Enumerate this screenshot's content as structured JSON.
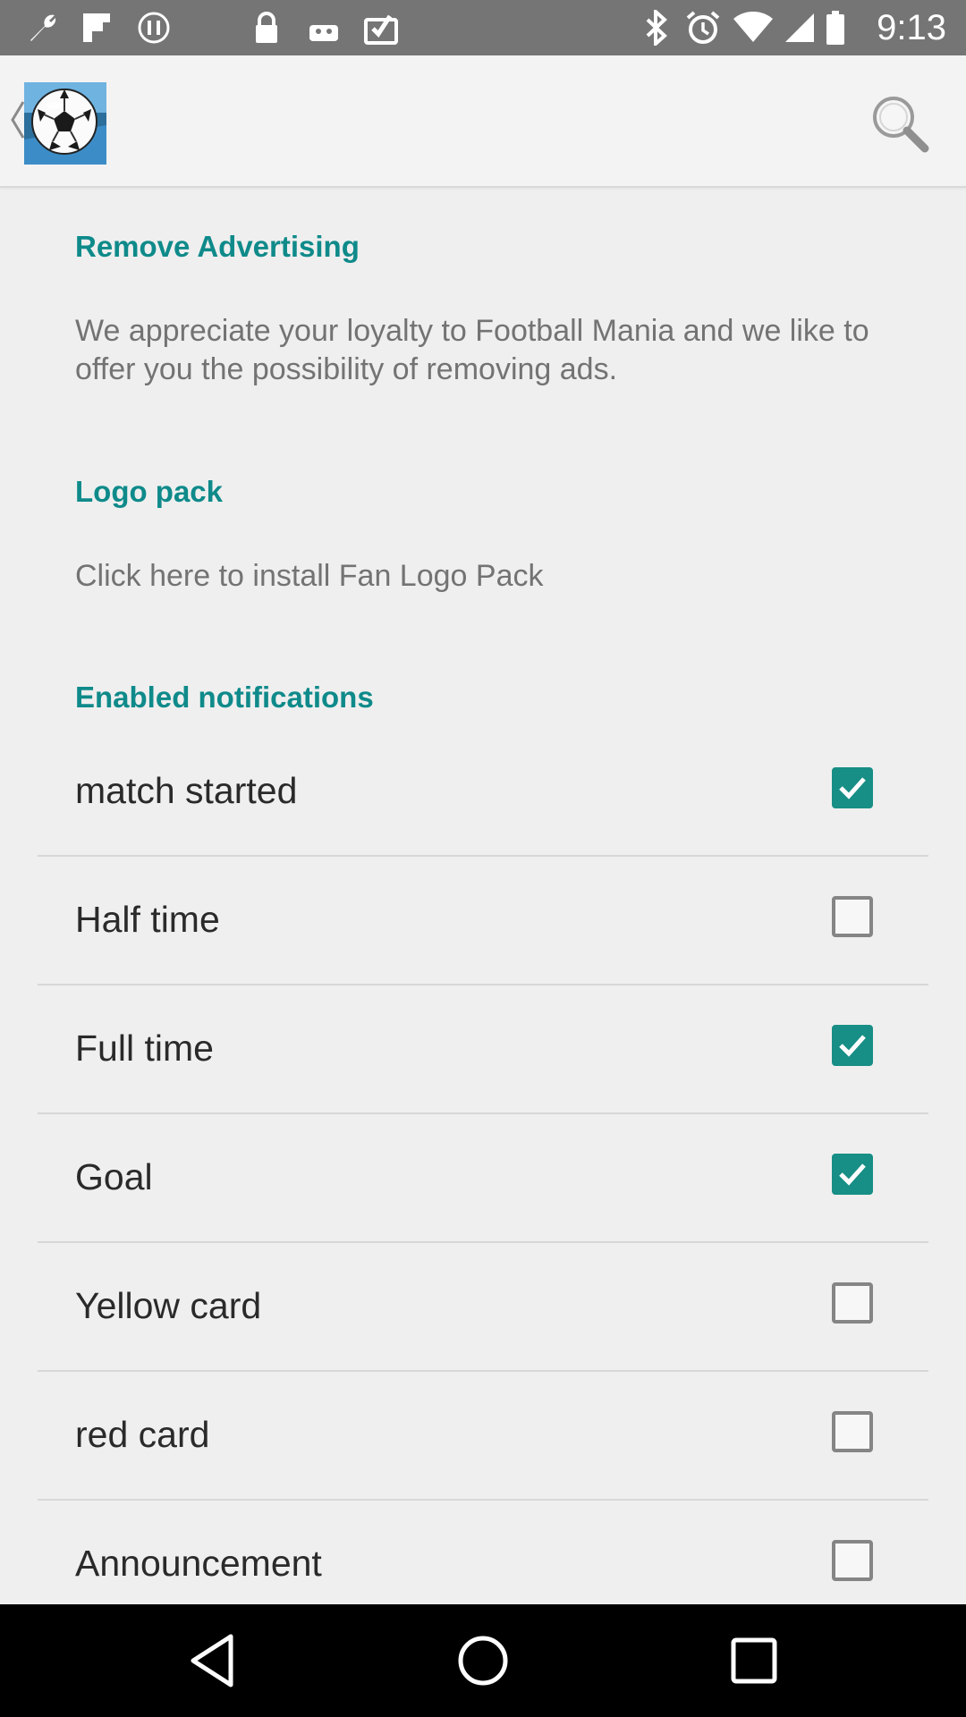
{
  "status_bar": {
    "time": "9:13",
    "left_icons": [
      "wrench-icon",
      "flipboard-icon",
      "signal-circle-icon",
      "lock-icon",
      "android-icon",
      "clipboard-check-icon"
    ],
    "right_icons": [
      "bluetooth-icon",
      "alarm-icon",
      "wifi-icon",
      "cellular-icon",
      "battery-icon"
    ]
  },
  "app_bar": {
    "logo_icon": "soccer-ball-icon",
    "search_icon": "search-icon"
  },
  "sections": {
    "remove_ads": {
      "title": "Remove Advertising",
      "summary": "We appreciate your loyalty to Football Mania and we like to offer you the possibility of removing ads."
    },
    "logo_pack": {
      "title": "Logo pack",
      "summary": "Click here to install Fan Logo Pack"
    },
    "notifications": {
      "title": "Enabled notifications",
      "items": [
        {
          "label": "match started",
          "checked": true
        },
        {
          "label": "Half time",
          "checked": false
        },
        {
          "label": "Full time",
          "checked": true
        },
        {
          "label": "Goal",
          "checked": true
        },
        {
          "label": "Yellow card",
          "checked": false
        },
        {
          "label": "red card",
          "checked": false
        },
        {
          "label": "Announcement",
          "checked": false
        }
      ]
    }
  },
  "colors": {
    "accent": "#0f8a8a",
    "checkbox_checked": "#178e86",
    "status_bar": "#757575",
    "nav_bar": "#000000"
  }
}
